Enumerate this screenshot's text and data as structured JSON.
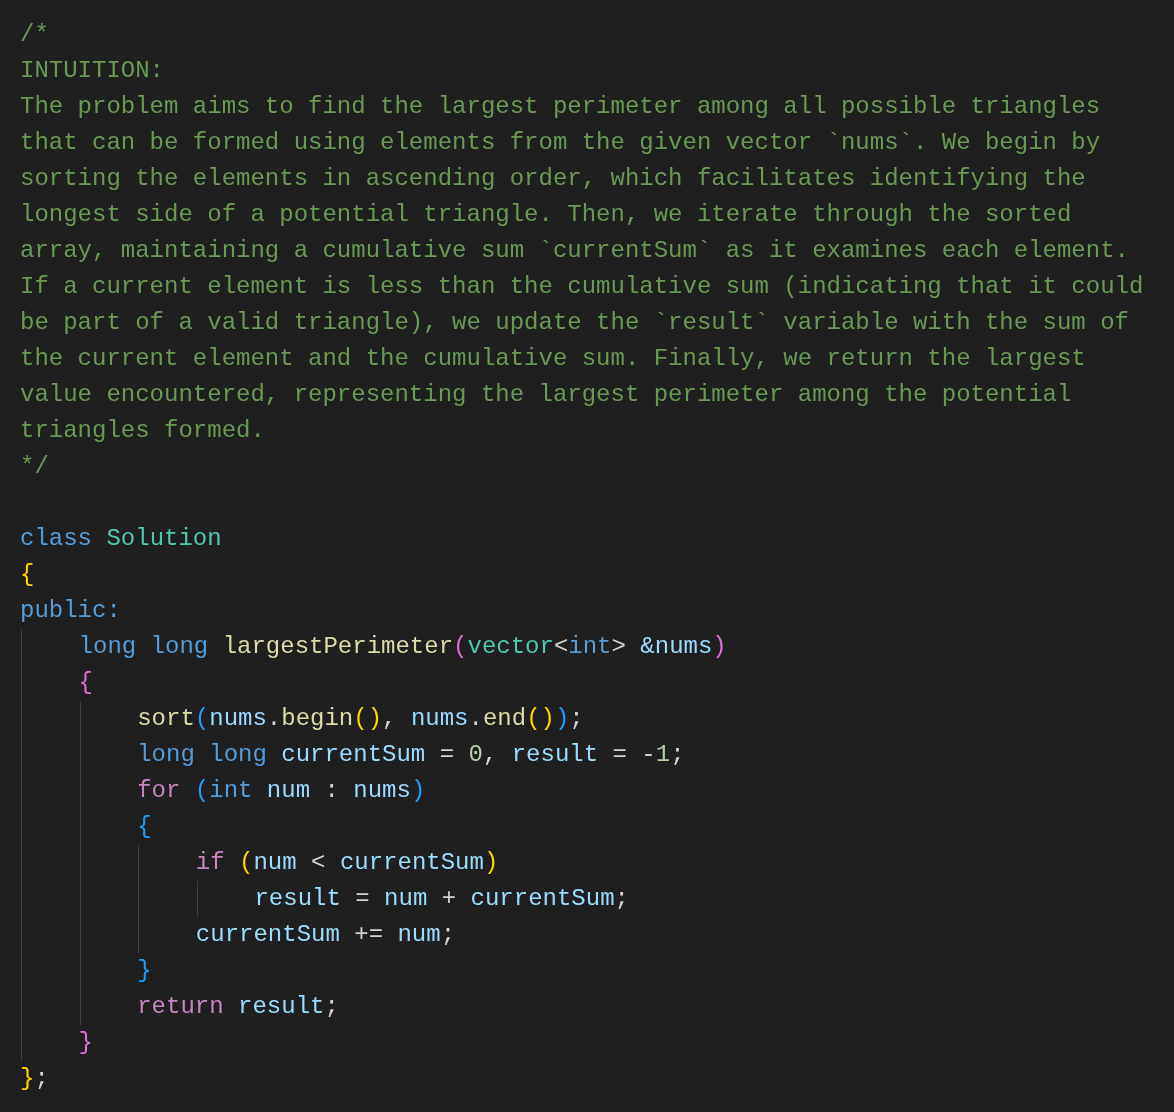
{
  "editor": {
    "lines": [
      {
        "kind": "comment",
        "text": "/*"
      },
      {
        "kind": "comment",
        "text": "INTUITION:"
      },
      {
        "kind": "comment",
        "text": "The problem aims to find the largest perimeter among all possible triangles"
      },
      {
        "kind": "comment",
        "text": "that can be formed using elements from the given vector `nums`. We begin by"
      },
      {
        "kind": "comment",
        "text": "sorting the elements in ascending order, which facilitates identifying the"
      },
      {
        "kind": "comment",
        "text": "longest side of a potential triangle. Then, we iterate through the sorted"
      },
      {
        "kind": "comment",
        "text": "array, maintaining a cumulative sum `currentSum` as it examines each element."
      },
      {
        "kind": "comment",
        "text": "If a current element is less than the cumulative sum (indicating that it could"
      },
      {
        "kind": "comment",
        "text": "be part of a valid triangle), we update the `result` variable with the sum of"
      },
      {
        "kind": "comment",
        "text": "the current element and the cumulative sum. Finally, we return the largest"
      },
      {
        "kind": "comment",
        "text": "value encountered, representing the largest perimeter among the potential"
      },
      {
        "kind": "comment",
        "text": "triangles formed."
      },
      {
        "kind": "comment",
        "text": "*/"
      },
      {
        "kind": "blank"
      },
      {
        "kind": "code",
        "tokens": [
          {
            "text": "class ",
            "kind": "keyword"
          },
          {
            "text": "Solution",
            "kind": "type"
          }
        ]
      },
      {
        "kind": "code",
        "tokens": [
          {
            "text": "{",
            "kind": "bracket1"
          }
        ]
      },
      {
        "kind": "code",
        "tokens": [
          {
            "text": "public:",
            "kind": "keyword"
          }
        ],
        "children": [
          {
            "kind": "code",
            "tokens": [
              {
                "text": "long long ",
                "kind": "keyword"
              },
              {
                "text": "largestPerimeter",
                "kind": "function"
              },
              {
                "text": "(",
                "kind": "bracket2"
              },
              {
                "text": "vector",
                "kind": "type"
              },
              {
                "text": "<",
                "kind": "plain"
              },
              {
                "text": "int",
                "kind": "keyword"
              },
              {
                "text": "> ",
                "kind": "plain"
              },
              {
                "text": "&nums",
                "kind": "variable"
              },
              {
                "text": ")",
                "kind": "bracket2"
              }
            ]
          },
          {
            "kind": "code",
            "tokens": [
              {
                "text": "{",
                "kind": "bracket2"
              }
            ],
            "children": [
              {
                "kind": "code",
                "tokens": [
                  {
                    "text": "sort",
                    "kind": "function"
                  },
                  {
                    "text": "(",
                    "kind": "bracket3"
                  },
                  {
                    "text": "nums",
                    "kind": "variable"
                  },
                  {
                    "text": ".",
                    "kind": "plain"
                  },
                  {
                    "text": "begin",
                    "kind": "function"
                  },
                  {
                    "text": "()",
                    "kind": "bracket1"
                  },
                  {
                    "text": ", ",
                    "kind": "plain"
                  },
                  {
                    "text": "nums",
                    "kind": "variable"
                  },
                  {
                    "text": ".",
                    "kind": "plain"
                  },
                  {
                    "text": "end",
                    "kind": "function"
                  },
                  {
                    "text": "()",
                    "kind": "bracket1"
                  },
                  {
                    "text": ")",
                    "kind": "bracket3"
                  },
                  {
                    "text": ";",
                    "kind": "plain"
                  }
                ]
              },
              {
                "kind": "code",
                "tokens": [
                  {
                    "text": "long long ",
                    "kind": "keyword"
                  },
                  {
                    "text": "currentSum",
                    "kind": "variable"
                  },
                  {
                    "text": " = ",
                    "kind": "plain"
                  },
                  {
                    "text": "0",
                    "kind": "number"
                  },
                  {
                    "text": ", ",
                    "kind": "plain"
                  },
                  {
                    "text": "result",
                    "kind": "variable"
                  },
                  {
                    "text": " = -",
                    "kind": "plain"
                  },
                  {
                    "text": "1",
                    "kind": "number"
                  },
                  {
                    "text": ";",
                    "kind": "plain"
                  }
                ]
              },
              {
                "kind": "code",
                "tokens": [
                  {
                    "text": "for ",
                    "kind": "control"
                  },
                  {
                    "text": "(",
                    "kind": "bracket3"
                  },
                  {
                    "text": "int ",
                    "kind": "keyword"
                  },
                  {
                    "text": "num",
                    "kind": "variable"
                  },
                  {
                    "text": " : ",
                    "kind": "plain"
                  },
                  {
                    "text": "nums",
                    "kind": "variable"
                  },
                  {
                    "text": ")",
                    "kind": "bracket3"
                  }
                ]
              },
              {
                "kind": "code",
                "tokens": [
                  {
                    "text": "{",
                    "kind": "bracket3"
                  }
                ],
                "children": [
                  {
                    "kind": "code",
                    "tokens": [
                      {
                        "text": "if ",
                        "kind": "control"
                      },
                      {
                        "text": "(",
                        "kind": "bracket1"
                      },
                      {
                        "text": "num",
                        "kind": "variable"
                      },
                      {
                        "text": " < ",
                        "kind": "plain"
                      },
                      {
                        "text": "currentSum",
                        "kind": "variable"
                      },
                      {
                        "text": ")",
                        "kind": "bracket1"
                      }
                    ],
                    "children": [
                      {
                        "kind": "code",
                        "tokens": [
                          {
                            "text": "result",
                            "kind": "variable"
                          },
                          {
                            "text": " = ",
                            "kind": "plain"
                          },
                          {
                            "text": "num",
                            "kind": "variable"
                          },
                          {
                            "text": " + ",
                            "kind": "plain"
                          },
                          {
                            "text": "currentSum",
                            "kind": "variable"
                          },
                          {
                            "text": ";",
                            "kind": "plain"
                          }
                        ]
                      }
                    ]
                  },
                  {
                    "kind": "code",
                    "tokens": [
                      {
                        "text": "currentSum",
                        "kind": "variable"
                      },
                      {
                        "text": " += ",
                        "kind": "plain"
                      },
                      {
                        "text": "num",
                        "kind": "variable"
                      },
                      {
                        "text": ";",
                        "kind": "plain"
                      }
                    ]
                  }
                ]
              },
              {
                "kind": "code",
                "tokens": [
                  {
                    "text": "}",
                    "kind": "bracket3"
                  }
                ]
              },
              {
                "kind": "code",
                "tokens": [
                  {
                    "text": "return ",
                    "kind": "control"
                  },
                  {
                    "text": "result",
                    "kind": "variable"
                  },
                  {
                    "text": ";",
                    "kind": "plain"
                  }
                ]
              }
            ]
          },
          {
            "kind": "code",
            "tokens": [
              {
                "text": "}",
                "kind": "bracket2"
              }
            ]
          }
        ]
      },
      {
        "kind": "code",
        "tokens": [
          {
            "text": "}",
            "kind": "bracket1"
          },
          {
            "text": ";",
            "kind": "plain"
          }
        ]
      }
    ]
  }
}
